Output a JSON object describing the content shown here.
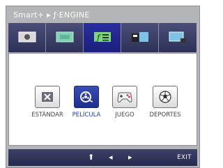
{
  "window": {
    "title": "Smart+ ▸ ƒ·ENGINE"
  },
  "tabs": [
    {
      "name": "picture"
    },
    {
      "name": "color"
    },
    {
      "name": "f-engine",
      "active": true
    },
    {
      "name": "tracking"
    },
    {
      "name": "setup"
    }
  ],
  "modes": [
    {
      "label": "ESTÁNDAR",
      "icon": "standard-icon"
    },
    {
      "label": "PELÍCULA",
      "icon": "film-reel-icon",
      "selected": true
    },
    {
      "label": "JUEGO",
      "icon": "gamepad-icon"
    },
    {
      "label": "DEPORTES",
      "icon": "soccer-ball-icon"
    }
  ],
  "bottom_bar": {
    "up": "⬆",
    "left": "◂",
    "right": "▸",
    "exit": "EXIT"
  },
  "colors": {
    "accent": "#1e3fbf",
    "frame": "#b4b5b8",
    "tab_bar": "#2d3056"
  }
}
